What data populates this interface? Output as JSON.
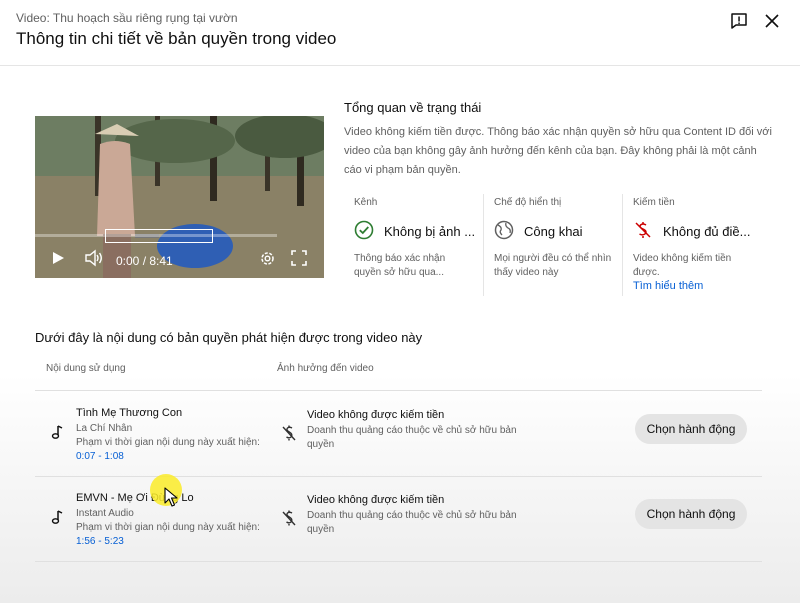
{
  "header": {
    "subtitle": "Video: Thu hoạch sầu riêng rụng tại vườn",
    "title": "Thông tin chi tiết về bản quyền trong video"
  },
  "player": {
    "time": "0:00 / 8:41"
  },
  "overview": {
    "title": "Tổng quan về trạng thái",
    "description": "Video không kiếm tiền được. Thông báo xác nhận quyền sở hữu qua Content ID đối với video của bạn không gây ảnh hưởng đến kênh của bạn. Đây không phải là một cảnh cáo vi phạm bản quyền."
  },
  "status": {
    "channel": {
      "label": "Kênh",
      "value": "Không bị ảnh ...",
      "desc": "Thông báo xác nhận quyền sở hữu qua..."
    },
    "visibility": {
      "label": "Chế độ hiển thị",
      "value": "Công khai",
      "desc": "Mọi người đều có thể nhìn thấy video này"
    },
    "monetization": {
      "label": "Kiếm tiền",
      "value": "Không đủ điề...",
      "desc": "Video không kiếm tiền được.",
      "link": "Tìm hiểu thêm"
    }
  },
  "claims": {
    "section_title": "Dưới đây là nội dung có bản quyền phát hiện được trong video này",
    "col_content": "Nội dung sử dụng",
    "col_impact": "Ảnh hưởng đến video",
    "rows": [
      {
        "song": "Tình Mẹ Thương Con",
        "artist": "La Chí Nhân",
        "range_label": "Phạm vi thời gian nội dung này xuất hiện:",
        "range": "0:07 - 1:08",
        "impact_title": "Video không được kiếm tiền",
        "impact_desc": "Doanh thu quảng cáo thuộc về chủ sở hữu bản quyền",
        "action": "Chọn hành động"
      },
      {
        "song": "EMVN - Mẹ Ơi Đừng Lo",
        "artist": "Instant Audio",
        "range_label": "Phạm vi thời gian nội dung này xuất hiện:",
        "range": "1:56 - 5:23",
        "impact_title": "Video không được kiếm tiền",
        "impact_desc": "Doanh thu quảng cáo thuộc về chủ sở hữu bản quyền",
        "action": "Chọn hành động"
      }
    ]
  },
  "colors": {
    "link": "#065fd4",
    "success_check": "#2e7d32",
    "demonetized": "#cc0000",
    "button_bg": "#e4e4e4"
  }
}
